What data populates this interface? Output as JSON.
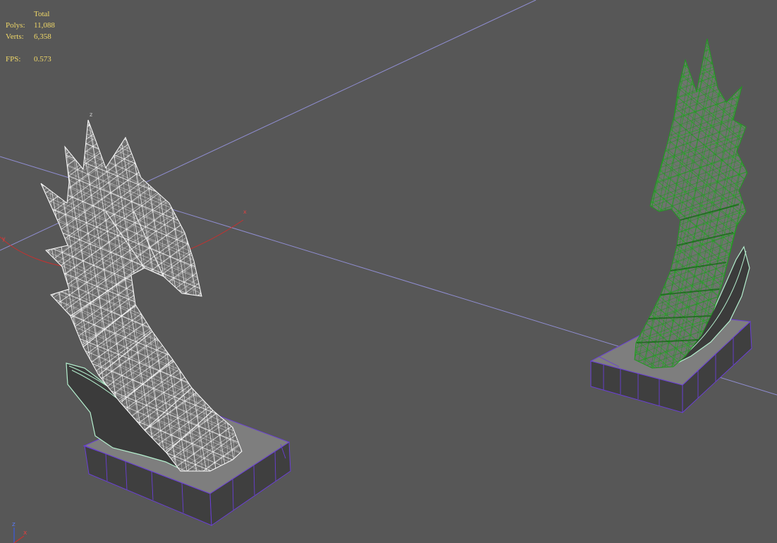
{
  "stats": {
    "title": "Total",
    "polys_label": "Polys:",
    "polys_value": "11,088",
    "verts_label": "Verts:",
    "verts_value": "6,358",
    "fps_label": "FPS:",
    "fps_value": "0.573"
  },
  "pivot_gizmo": {
    "z_label": "z",
    "x_label": "x",
    "y_label": "y"
  },
  "axis_tripod": {
    "z_label": "z",
    "x_label": "x"
  },
  "colors": {
    "background": "#575757",
    "grid": "#9a98e8",
    "stats_text": "#f0d868",
    "wire_white": "#ffffff",
    "wire_green": "#1f9a1f",
    "base_edge": "#6a3fd6",
    "fin_edge": "#b5f0cf",
    "x_axis": "#c8302e",
    "z_axis": "#3c5ae0"
  }
}
